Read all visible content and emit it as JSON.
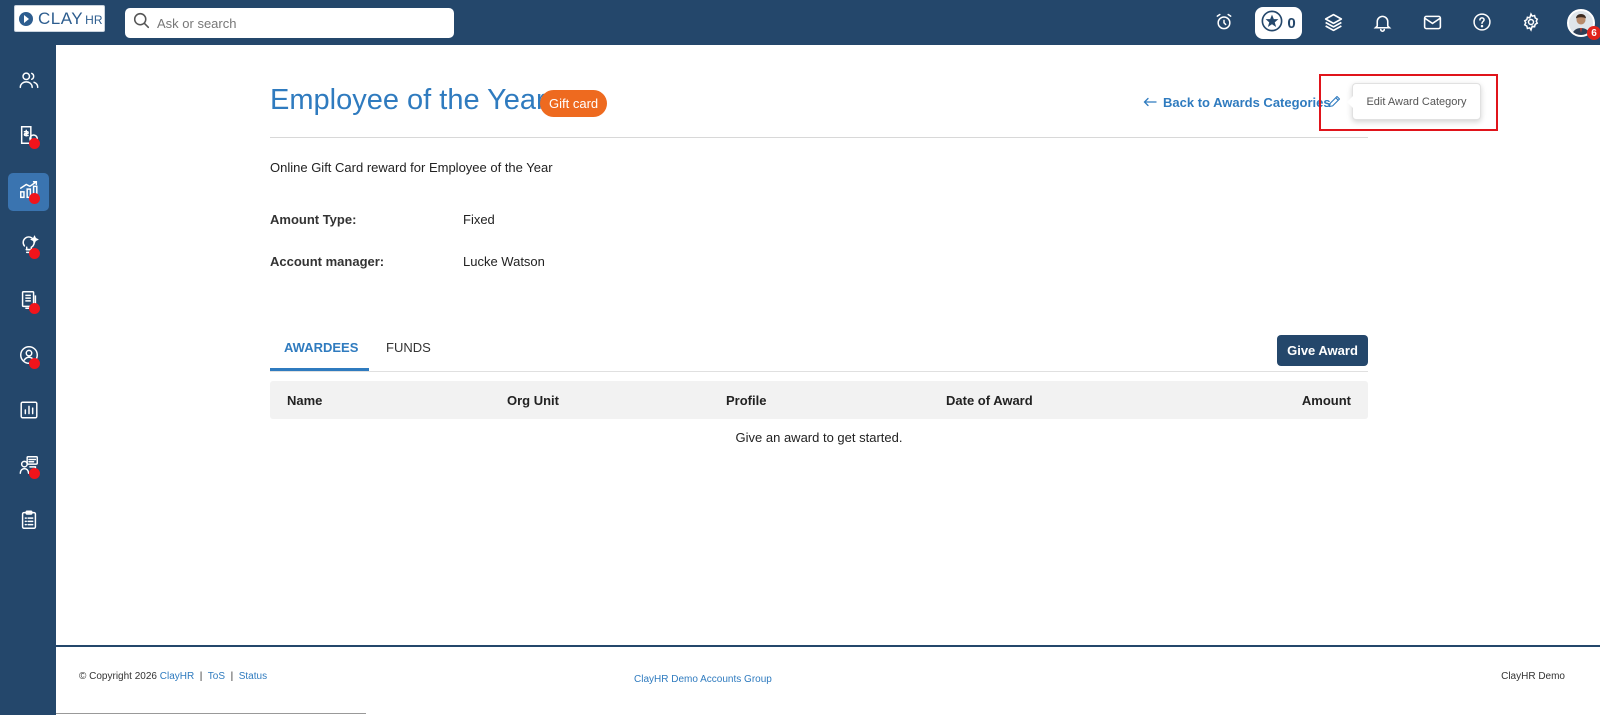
{
  "app": {
    "logo_text": "CLAY",
    "logo_suffix": "HR"
  },
  "search": {
    "placeholder": "Ask or search"
  },
  "topbar": {
    "stars_count": "0",
    "avatar_badge": "6",
    "icons": [
      "alarm-clock-icon",
      "star-icon",
      "layers-icon",
      "bell-icon",
      "mail-icon",
      "help-icon",
      "gear-icon"
    ]
  },
  "sidebar": {
    "items": [
      {
        "icon": "people-icon",
        "dot": false,
        "active": false
      },
      {
        "icon": "payroll-icon",
        "dot": true,
        "active": false
      },
      {
        "icon": "performance-chart-icon",
        "dot": true,
        "active": true
      },
      {
        "icon": "lightbulb-icon",
        "dot": true,
        "active": false
      },
      {
        "icon": "documents-icon",
        "dot": true,
        "active": false
      },
      {
        "icon": "profile-icon",
        "dot": true,
        "active": false
      },
      {
        "icon": "reports-icon",
        "dot": false,
        "active": false
      },
      {
        "icon": "support-icon",
        "dot": true,
        "active": false
      },
      {
        "icon": "clipboard-icon",
        "dot": false,
        "active": false
      }
    ],
    "dot_color": "#f0141b"
  },
  "page": {
    "title": "Employee of the Year",
    "badge": "Gift card",
    "back_link": "Back to Awards Categories",
    "edit_tooltip": "Edit Award Category",
    "description": "Online Gift Card reward for Employee of the Year",
    "amount_type_label": "Amount Type:",
    "amount_type_value": "Fixed",
    "account_manager_label": "Account manager:",
    "account_manager_value": "Lucke Watson"
  },
  "tabs": [
    {
      "label": "AWARDEES",
      "active": true
    },
    {
      "label": "FUNDS",
      "active": false
    }
  ],
  "give_award_button": "Give Award",
  "table": {
    "columns": [
      "Name",
      "Org Unit",
      "Profile",
      "Date of Award",
      "Amount"
    ],
    "empty_message": "Give an award to get started."
  },
  "footer": {
    "copyright": "© Copyright 2026",
    "company_link": "ClayHR",
    "separator": "|",
    "tos_link": "ToS",
    "status_link": "Status",
    "center_text": "ClayHR Demo Accounts Group",
    "right_text": "ClayHR Demo"
  },
  "colors": {
    "navy": "#24476b",
    "accent_blue": "#2f7bbf",
    "badge_orange": "#ee6a1f",
    "highlight_red": "#e0141b"
  }
}
